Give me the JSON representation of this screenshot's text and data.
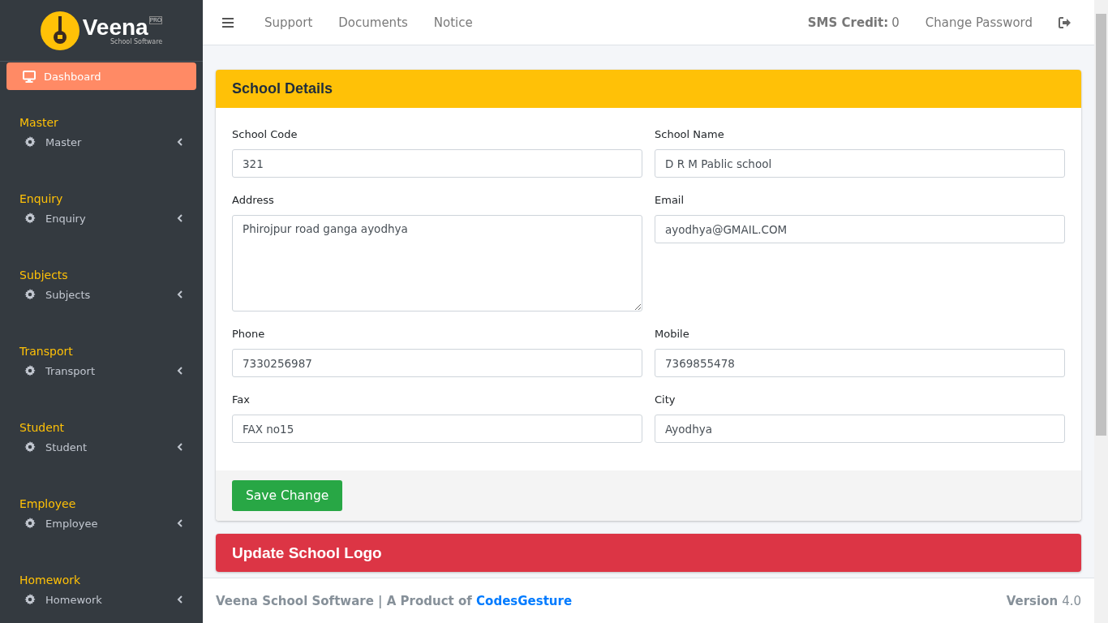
{
  "logo": {
    "name": "Veena",
    "badge": "PRO",
    "tagline": "School Software"
  },
  "sidebar": {
    "items": [
      {
        "label": "Dashboard",
        "selected": true
      }
    ],
    "sections": [
      {
        "heading": "Master",
        "items": [
          {
            "label": "Master",
            "expanded": false
          }
        ]
      },
      {
        "heading": "Enquiry",
        "items": [
          {
            "label": "Enquiry",
            "expanded": false
          }
        ]
      },
      {
        "heading": "Subjects",
        "items": [
          {
            "label": "Subjects",
            "expanded": false
          }
        ]
      },
      {
        "heading": "Transport",
        "items": [
          {
            "label": "Transport",
            "expanded": false
          }
        ]
      },
      {
        "heading": "Student",
        "items": [
          {
            "label": "Student",
            "expanded": false
          }
        ]
      },
      {
        "heading": "Employee",
        "items": [
          {
            "label": "Employee",
            "expanded": false
          }
        ]
      },
      {
        "heading": "Homework",
        "items": [
          {
            "label": "Homework",
            "expanded": false
          }
        ]
      }
    ]
  },
  "topbar": {
    "links": [
      "Support",
      "Documents",
      "Notice"
    ],
    "sms_label": "SMS Credit:",
    "sms_value": "0",
    "change_password": "Change Password"
  },
  "cards": [
    {
      "title": "School Details",
      "color": "#ffc107",
      "fields": [
        {
          "label": "School Code",
          "value": "321",
          "kind": "input"
        },
        {
          "label": "School Name",
          "value": "D R M Pablic school",
          "kind": "input"
        },
        {
          "label": "Address",
          "value": "Phirojpur road ganga ayodhya",
          "kind": "textarea"
        },
        {
          "label": "Email",
          "value": "ayodhya@GMAIL.COM",
          "kind": "input"
        },
        {
          "label": "Phone",
          "value": "7330256987",
          "kind": "input"
        },
        {
          "label": "Mobile",
          "value": "7369855478",
          "kind": "input"
        },
        {
          "label": "Fax",
          "value": "FAX no15",
          "kind": "input"
        },
        {
          "label": "City",
          "value": "Ayodhya",
          "kind": "input"
        }
      ],
      "button": "Save Change"
    },
    {
      "title": "Update School Logo",
      "color": "#dc3545"
    }
  ],
  "footer": {
    "text": "Veena School Software | A Product of ",
    "link": "CodesGesture",
    "version_label": "Version",
    "version": "4.0"
  }
}
